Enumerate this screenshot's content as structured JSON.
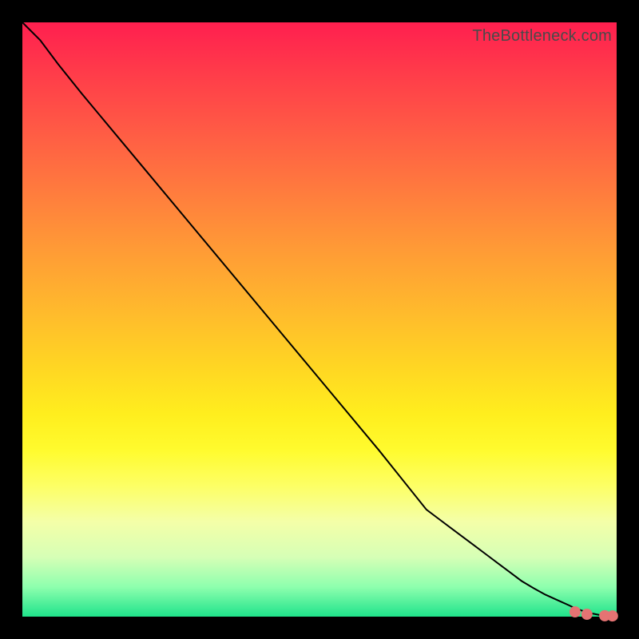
{
  "watermark": "TheBottleneck.com",
  "colors": {
    "background": "#000000",
    "curve": "#000000",
    "marker": "#e57373",
    "gradient_top": "#ff1f4f",
    "gradient_bottom": "#1fe38b"
  },
  "chart_data": {
    "type": "line",
    "title": "",
    "xlabel": "",
    "ylabel": "",
    "xlim": [
      0,
      100
    ],
    "ylim": [
      0,
      100
    ],
    "curve": {
      "name": "bottleneck-curve",
      "x": [
        0,
        3,
        6,
        10,
        20,
        30,
        40,
        50,
        60,
        68,
        70,
        72,
        74,
        76,
        78,
        80,
        82,
        84,
        86,
        88,
        90,
        92,
        93,
        94.5,
        96,
        97,
        98.5,
        99.5
      ],
      "y": [
        100,
        97,
        93,
        88,
        76,
        64,
        52,
        40,
        28,
        18,
        16.5,
        15,
        13.5,
        12,
        10.5,
        9,
        7.5,
        6,
        4.8,
        3.7,
        2.8,
        1.9,
        1.4,
        0.9,
        0.5,
        0.3,
        0.15,
        0.1
      ]
    },
    "highlight_segments": [
      {
        "x0": 65.5,
        "y0": 21.2,
        "x1": 70.0,
        "y1": 16.5
      },
      {
        "x0": 70.5,
        "y0": 16.0,
        "x1": 74.5,
        "y1": 12.8
      },
      {
        "x0": 75.0,
        "y0": 12.3,
        "x1": 79.0,
        "y1": 9.2
      },
      {
        "x0": 79.5,
        "y0": 8.8,
        "x1": 83.5,
        "y1": 6.0
      },
      {
        "x0": 84.5,
        "y0": 5.3,
        "x1": 87.5,
        "y1": 3.5
      },
      {
        "x0": 88.0,
        "y0": 3.2,
        "x1": 90.5,
        "y1": 2.1
      }
    ],
    "highlight_points": [
      {
        "x": 93.0,
        "y": 0.8
      },
      {
        "x": 95.0,
        "y": 0.4
      },
      {
        "x": 98.0,
        "y": 0.15
      },
      {
        "x": 99.3,
        "y": 0.12
      }
    ]
  }
}
